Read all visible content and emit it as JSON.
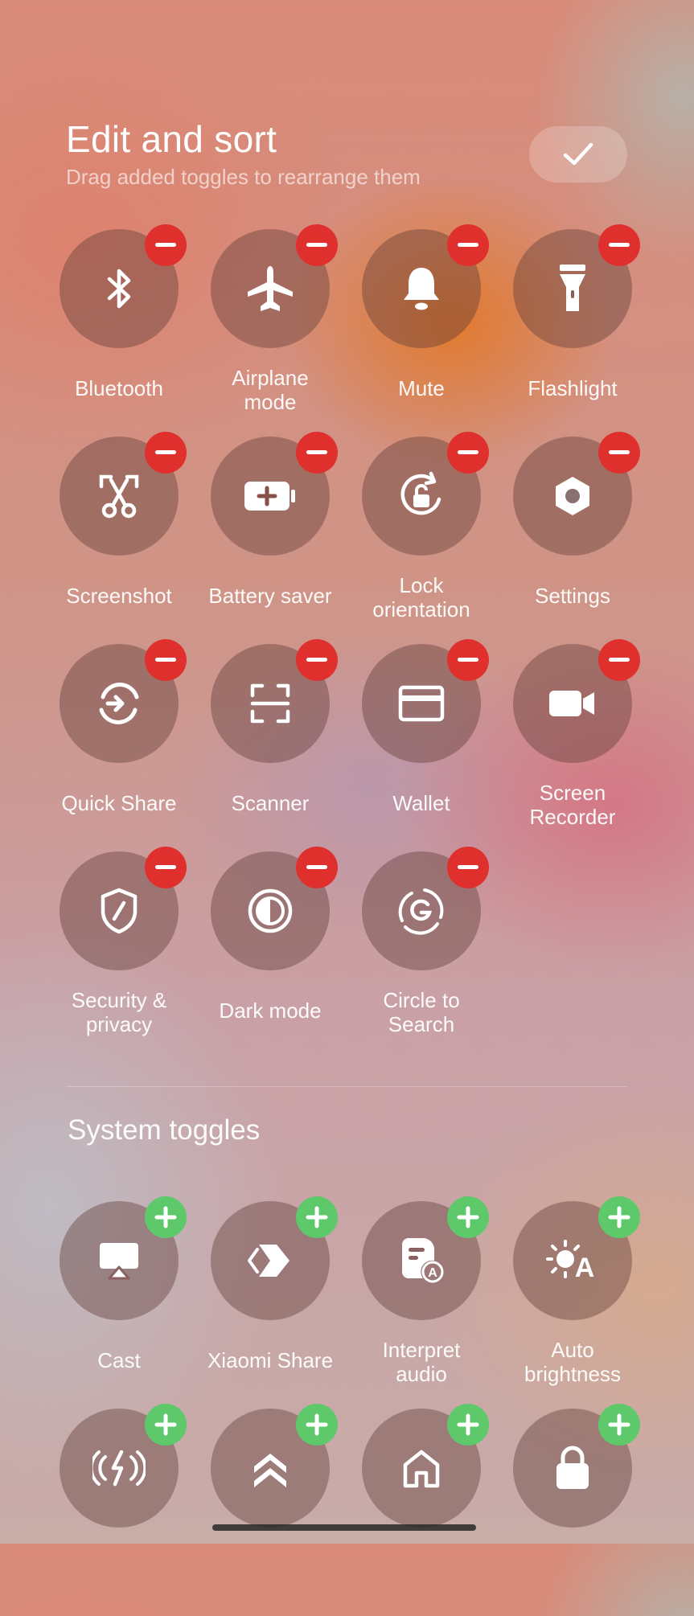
{
  "header": {
    "title": "Edit and sort",
    "subtitle": "Drag added toggles to rearrange them",
    "done_icon": "check-icon"
  },
  "added_toggles": [
    {
      "label": "Bluetooth",
      "icon": "bluetooth-icon"
    },
    {
      "label": "Airplane\nmode",
      "icon": "airplane-icon"
    },
    {
      "label": "Mute",
      "icon": "bell-icon"
    },
    {
      "label": "Flashlight",
      "icon": "flashlight-icon"
    },
    {
      "label": "Screenshot",
      "icon": "scissors-icon"
    },
    {
      "label": "Battery saver",
      "icon": "battery-saver-icon"
    },
    {
      "label": "Lock\norientation",
      "icon": "lock-rotation-icon"
    },
    {
      "label": "Settings",
      "icon": "gear-icon"
    },
    {
      "label": "Quick Share",
      "icon": "quick-share-icon"
    },
    {
      "label": "Scanner",
      "icon": "scanner-icon"
    },
    {
      "label": "Wallet",
      "icon": "wallet-icon"
    },
    {
      "label": "Screen\nRecorder",
      "icon": "video-camera-icon"
    },
    {
      "label": "Security &\nprivacy",
      "icon": "shield-icon"
    },
    {
      "label": "Dark mode",
      "icon": "dark-mode-icon"
    },
    {
      "label": "Circle to\nSearch",
      "icon": "circle-to-search-icon"
    }
  ],
  "system_section": {
    "title": "System toggles"
  },
  "system_toggles": [
    {
      "label": "Cast",
      "icon": "cast-icon"
    },
    {
      "label": "Xiaomi Share",
      "icon": "xiaomi-share-icon"
    },
    {
      "label": "Interpret\naudio",
      "icon": "interpret-audio-icon"
    },
    {
      "label": "Auto\nbrightness",
      "icon": "auto-brightness-icon"
    },
    {
      "label": "",
      "icon": "wireless-charging-icon"
    },
    {
      "label": "",
      "icon": "double-chevron-up-icon"
    },
    {
      "label": "",
      "icon": "home-icon"
    },
    {
      "label": "",
      "icon": "lock-icon"
    }
  ],
  "colors": {
    "remove_badge": "#e0302e",
    "add_badge": "#5ec96a"
  }
}
